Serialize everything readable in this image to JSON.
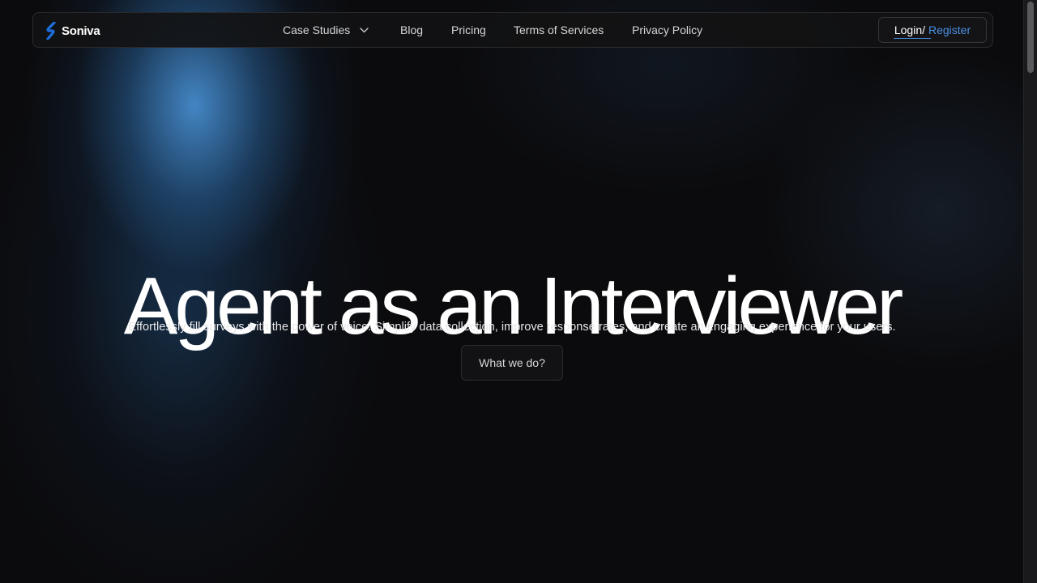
{
  "brand": {
    "name": "Soniva",
    "icon": "soniva-logo-icon",
    "accent_color": "#1e6fe0"
  },
  "nav": {
    "items": [
      {
        "label": "Case Studies",
        "has_dropdown": true
      },
      {
        "label": "Blog"
      },
      {
        "label": "Pricing"
      },
      {
        "label": "Terms of Services"
      },
      {
        "label": "Privacy Policy"
      }
    ],
    "auth": {
      "login_label": "Login",
      "separator": "/",
      "register_label": "Register",
      "register_color": "#4a90e2"
    }
  },
  "hero": {
    "title": "Agent as an Interviewer",
    "subtitle": "Effortlessly fill surveys with the power of voice. Simplify data collection, improve response rates, and create an engaging experience for your users.",
    "cta_label": "What we do?"
  },
  "colors": {
    "background": "#0b0b0d",
    "glow": "#468ccd"
  }
}
